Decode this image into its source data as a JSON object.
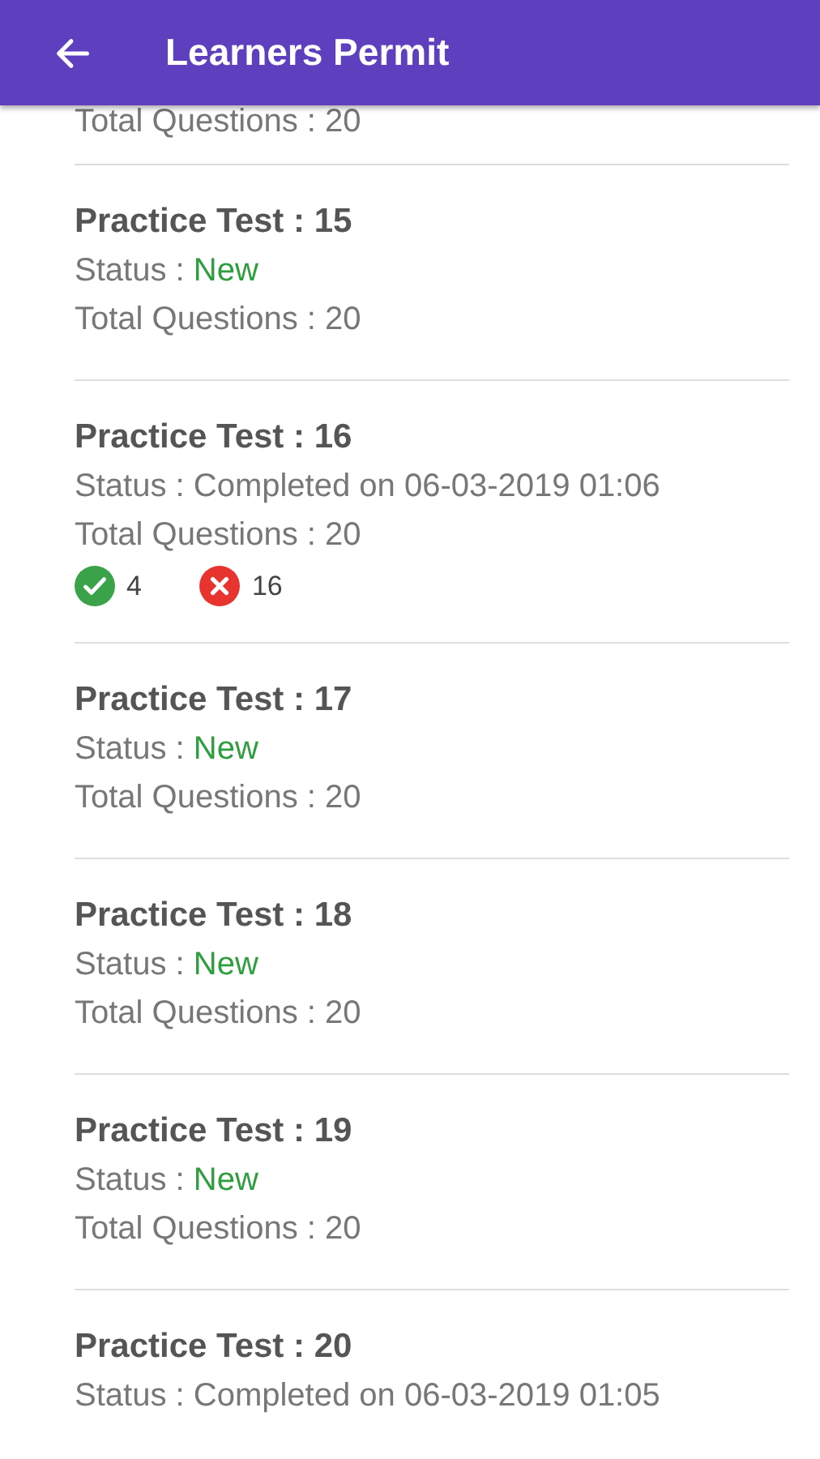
{
  "app_bar": {
    "title": "Learners Permit"
  },
  "partial_item": {
    "total": "Total Questions : 20"
  },
  "tests": [
    {
      "title": "Practice Test : 15",
      "status_label": "Status : ",
      "status": "New",
      "completed": false,
      "total": "Total Questions : 20"
    },
    {
      "title": "Practice Test : 16",
      "status_label": "Status : ",
      "status": "Completed on 06-03-2019 01:06",
      "completed": true,
      "total": "Total Questions : 20",
      "correct": "4",
      "wrong": "16"
    },
    {
      "title": "Practice Test : 17",
      "status_label": "Status : ",
      "status": "New",
      "completed": false,
      "total": "Total Questions : 20"
    },
    {
      "title": "Practice Test : 18",
      "status_label": "Status : ",
      "status": "New",
      "completed": false,
      "total": "Total Questions : 20"
    },
    {
      "title": "Practice Test : 19",
      "status_label": "Status : ",
      "status": "New",
      "completed": false,
      "total": "Total Questions : 20"
    },
    {
      "title": "Practice Test : 20",
      "status_label": "Status : ",
      "status": "Completed on 06-03-2019 01:05",
      "completed": true
    }
  ]
}
